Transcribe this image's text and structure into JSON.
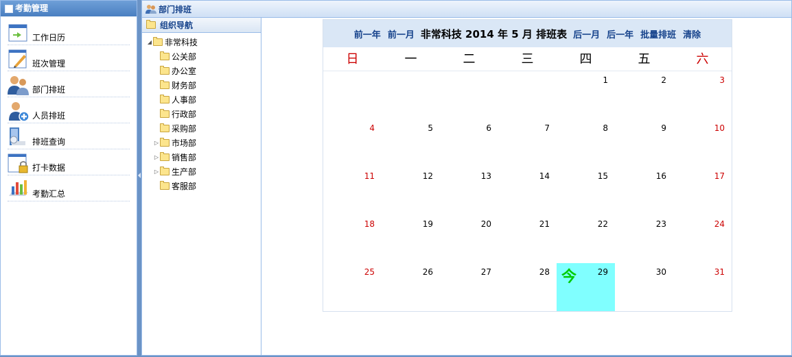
{
  "left_panel": {
    "title": "考勤管理",
    "menu": [
      {
        "label": "工作日历",
        "icon": "calendar-icon"
      },
      {
        "label": "班次管理",
        "icon": "edit-icon"
      },
      {
        "label": "部门排班",
        "icon": "department-users-icon"
      },
      {
        "label": "人员排班",
        "icon": "add-user-icon"
      },
      {
        "label": "排班查询",
        "icon": "search-schedule-icon"
      },
      {
        "label": "打卡数据",
        "icon": "lock-window-icon"
      },
      {
        "label": "考勤汇总",
        "icon": "summary-chart-icon"
      }
    ]
  },
  "main_panel": {
    "title": "部门排班",
    "tree": {
      "title": "组织导航",
      "root": "非常科技",
      "nodes": [
        {
          "label": "公关部",
          "expandable": false
        },
        {
          "label": "办公室",
          "expandable": false
        },
        {
          "label": "财务部",
          "expandable": false
        },
        {
          "label": "人事部",
          "expandable": false
        },
        {
          "label": "行政部",
          "expandable": false
        },
        {
          "label": "采购部",
          "expandable": false
        },
        {
          "label": "市场部",
          "expandable": true
        },
        {
          "label": "销售部",
          "expandable": true
        },
        {
          "label": "生产部",
          "expandable": true
        },
        {
          "label": "客服部",
          "expandable": false
        }
      ]
    },
    "calendar": {
      "prev_year": "前一年",
      "prev_month": "前一月",
      "title": "非常科技 2014 年 5 月 排班表",
      "next_month": "后一月",
      "next_year": "后一年",
      "batch": "批量排班",
      "clear": "清除",
      "weekdays": [
        "日",
        "一",
        "二",
        "三",
        "四",
        "五",
        "六"
      ],
      "weeks": [
        [
          "",
          "",
          "",
          "",
          "1",
          "2",
          "3"
        ],
        [
          "4",
          "5",
          "6",
          "7",
          "8",
          "9",
          "10"
        ],
        [
          "11",
          "12",
          "13",
          "14",
          "15",
          "16",
          "17"
        ],
        [
          "18",
          "19",
          "20",
          "21",
          "22",
          "23",
          "24"
        ],
        [
          "25",
          "26",
          "27",
          "28",
          "29",
          "30",
          "31"
        ]
      ],
      "today": "29",
      "today_mark": "今",
      "colors": {
        "weekend": "#cc0000",
        "today_bg": "#80ffff",
        "today_mark": "#00cc00",
        "link": "#15428b"
      }
    }
  }
}
